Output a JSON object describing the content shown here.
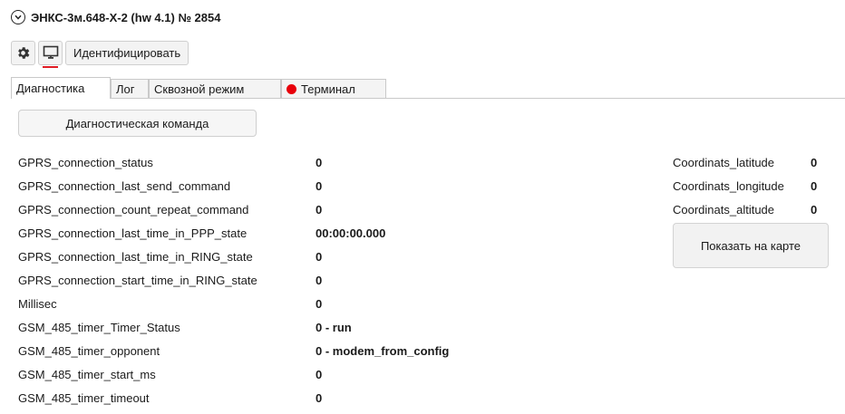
{
  "header": {
    "collapse_icon": "chevron-down-circle-icon",
    "title": "ЭНКС-3м.648-Х-2 (hw 4.1) № 2854"
  },
  "toolbar": {
    "settings_icon": "gear-icon",
    "monitor_icon": "monitor-icon",
    "identify_label": "Идентифицировать",
    "active_indicator_color": "#e01b24"
  },
  "tabs": [
    {
      "label": "Диагностика",
      "active": true
    },
    {
      "label": "Лог",
      "active": false
    },
    {
      "label": "Сквозной режим",
      "active": false
    },
    {
      "label": "Терминал",
      "active": false,
      "indicator_color": "#e8000b"
    }
  ],
  "diagnostics": {
    "command_button_label": "Диагностическая команда",
    "params": [
      {
        "name": "GPRS_connection_status",
        "value": "0"
      },
      {
        "name": "GPRS_connection_last_send_command",
        "value": "0"
      },
      {
        "name": "GPRS_connection_count_repeat_command",
        "value": "0"
      },
      {
        "name": "GPRS_connection_last_time_in_PPP_state",
        "value": "00:00:00.000"
      },
      {
        "name": "GPRS_connection_last_time_in_RING_state",
        "value": "0"
      },
      {
        "name": "GPRS_connection_start_time_in_RING_state",
        "value": "0"
      },
      {
        "name": "Millisec",
        "value": "0"
      },
      {
        "name": "GSM_485_timer_Timer_Status",
        "value": "0 - run"
      },
      {
        "name": "GSM_485_timer_opponent",
        "value": "0 - modem_from_config"
      },
      {
        "name": "GSM_485_timer_start_ms",
        "value": "0"
      },
      {
        "name": "GSM_485_timer_timeout",
        "value": "0"
      }
    ]
  },
  "coordinates": {
    "items": [
      {
        "name": "Coordinats_latitude",
        "value": "0"
      },
      {
        "name": "Coordinats_longitude",
        "value": "0"
      },
      {
        "name": "Coordinats_altitude",
        "value": "0"
      }
    ],
    "map_button_label": "Показать на карте"
  }
}
